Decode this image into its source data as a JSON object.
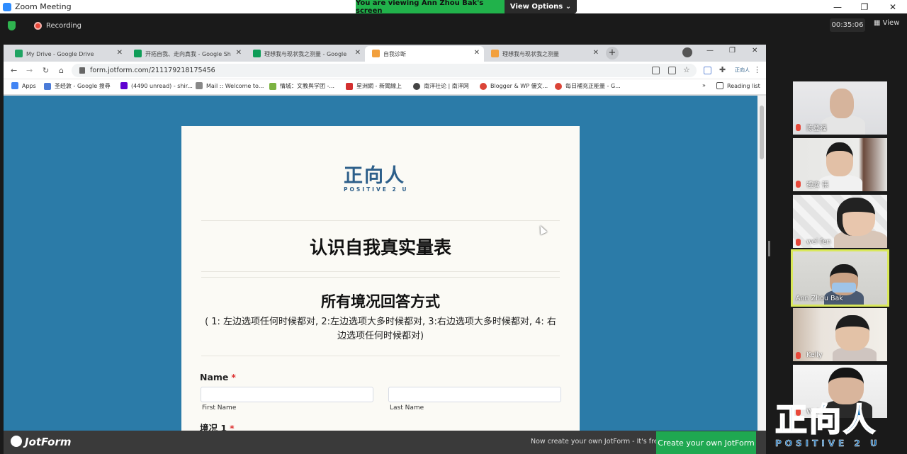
{
  "zoom": {
    "app_title": "Zoom Meeting",
    "viewing_banner": "You are viewing Ann Zhou Bak's screen",
    "view_options": "View Options ⌄",
    "recording": "Recording",
    "timer": "00:35:06",
    "view_button": "View"
  },
  "browser": {
    "tabs": [
      {
        "title": "My Drive - Google Drive",
        "icon_color": "#1fa463"
      },
      {
        "title": "开拓自我、走向真我 - Google Sh",
        "icon_color": "#0f9d58"
      },
      {
        "title": "理想我与现状我之测量 - Google",
        "icon_color": "#0f9d58"
      },
      {
        "title": "自我诊断",
        "icon_color": "#f2a03d"
      },
      {
        "title": "理想我与现状我之测量",
        "icon_color": "#f2a03d"
      }
    ],
    "url": "form.jotform.com/211179218175456",
    "bookmarks": [
      {
        "label": "Apps",
        "icon": "apps-grid-icon",
        "color": "#4285f4"
      },
      {
        "label": "圣经敦 - Google 搜尋",
        "icon": "bible-icon",
        "color": "#4a7bd8"
      },
      {
        "label": "(4490 unread) - shir...",
        "icon": "yahoo-icon",
        "color": "#5f01d1"
      },
      {
        "label": "Mail :: Welcome to...",
        "icon": "mail-icon",
        "color": "#888888"
      },
      {
        "label": "情城：文教與学团 -...",
        "icon": "site-icon",
        "color": "#7cb342"
      },
      {
        "label": "星洲網 - 新聞線上",
        "icon": "pin-icon",
        "color": "#d32f2f"
      },
      {
        "label": "南洋社论 | 南洋网",
        "icon": "globe-icon",
        "color": "#444444"
      },
      {
        "label": "Blogger & WP 優文...",
        "icon": "google-plus-icon",
        "color": "#db4437"
      },
      {
        "label": "每日補充正能量 - G...",
        "icon": "google-plus-icon",
        "color": "#db4437"
      }
    ],
    "reading_list": "Reading list"
  },
  "form": {
    "logo_zh": "正向人",
    "logo_en": "POSITIVE 2 U",
    "title": "认识自我真实量表",
    "subtitle": "所有境况回答方式",
    "description": "( 1: 左边选项任何时候都对, 2:左边选项大多时候都对, 3:右边选项大多时候都对, 4: 右边选项任何时候都对)",
    "name_label": "Name",
    "required_mark": "*",
    "first_name_label": "First Name",
    "last_name_label": "Last Name",
    "situation_label": "境况 1"
  },
  "jotform_bar": {
    "logo": "JotForm",
    "note": "Now create your own JotForm - It's free!",
    "cta": "Create your own JotForm"
  },
  "participants": [
    {
      "name": "陈登福"
    },
    {
      "name": "禮安 張"
    },
    {
      "name": "wei fen"
    },
    {
      "name": "Ann Zhou Bak"
    },
    {
      "name": "Kelly"
    },
    {
      "name": "Wei"
    }
  ],
  "watermark": {
    "zh": "正向人",
    "en": "POSITIVE 2 U"
  }
}
